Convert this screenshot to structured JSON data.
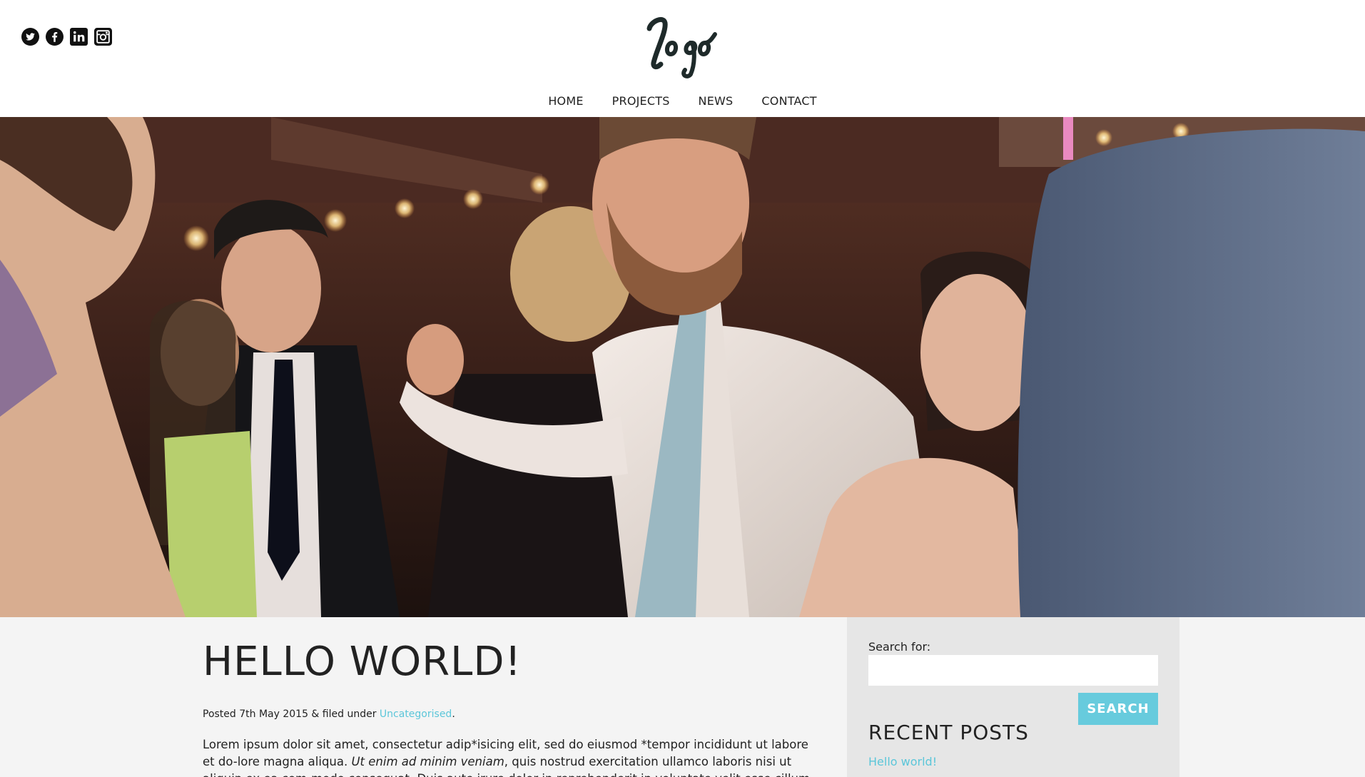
{
  "header": {
    "logo_text": "logo",
    "social": [
      {
        "icon": "twitter-icon"
      },
      {
        "icon": "facebook-icon"
      },
      {
        "icon": "linkedin-icon"
      },
      {
        "icon": "instagram-icon"
      }
    ],
    "nav": [
      {
        "label": "HOME"
      },
      {
        "label": "PROJECTS"
      },
      {
        "label": "NEWS"
      },
      {
        "label": "CONTACT"
      }
    ]
  },
  "post": {
    "title": "HELLO WORLD!",
    "meta_prefix": "Posted 7th May 2015 & filed under ",
    "category": "Uncategorised",
    "meta_suffix": ".",
    "body_part1": "Lorem ipsum dolor sit amet, consectetur adip*isicing elit, sed do eiusmod *tempor incididunt ut labore et do-lore magna aliqua. ",
    "body_em": "Ut enim ad minim veniam",
    "body_part2": ", quis nostrud exercitation ullamco laboris nisi ut aliquip ex ea com-modo consequat. Duis aute irure dolor in reprehenderit in voluptate velit esse cillum dolore eu fugiat nulla"
  },
  "sidebar": {
    "search_label": "Search for:",
    "search_value": "",
    "search_button": "SEARCH",
    "recent_title": "RECENT POSTS",
    "recent_posts": [
      {
        "label": "Hello world!"
      }
    ]
  },
  "colors": {
    "accent": "#67cbdd",
    "link": "#5bc6d9",
    "content_bg": "#f4f4f4",
    "sidebar_bg": "#e6e6e6"
  }
}
